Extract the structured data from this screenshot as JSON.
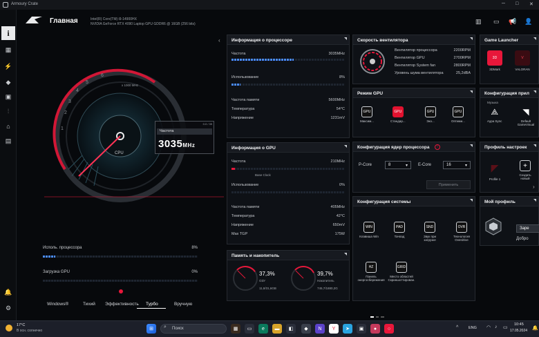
{
  "window": {
    "title": "Armoury Crate"
  },
  "header": {
    "title": "Главная",
    "cpu": "Intel(R) Core(TM) i9-14900HX",
    "gpu": "NVIDIA GeForce RTX 4090 Laptop GPU GDDR6 @ 16GB (256 bits)"
  },
  "gauge": {
    "ticks": [
      "1",
      "2",
      "3",
      "4",
      "5",
      "6"
    ],
    "unit": "x 1000 MHz",
    "label": "CPU",
    "freq_label": "Частота",
    "value": "3035",
    "value_unit": "MHz",
    "range": "0.0 / 39",
    "accent": "#e8173a"
  },
  "cpu_usage": {
    "label": "Исполь. процессора",
    "value": "8%",
    "pct": 8
  },
  "gpu_load": {
    "label": "Загрузка GPU",
    "value": "0%",
    "pct": 0
  },
  "modes": {
    "items": [
      "Windows®",
      "Тихий",
      "Эффективность",
      "Турбо",
      "Вручную"
    ],
    "active": "Турбо"
  },
  "cpu_info": {
    "title": "Информация о процессоре",
    "freq_label": "Частота",
    "freq_value": "3035MHz",
    "freq_pct": 55,
    "usage_label": "Использование",
    "usage_value": "8%",
    "usage_pct": 8,
    "rows": [
      {
        "label": "Частота памяти",
        "value": "5600MHz"
      },
      {
        "label": "Температура",
        "value": "54°C"
      },
      {
        "label": "Напряжение",
        "value": "1231mV"
      }
    ]
  },
  "gpu_info": {
    "title": "Информация о GPU",
    "freq_label": "Частота",
    "freq_value": "210MHz",
    "base_clock": "Base Clock",
    "usage_label": "Использование",
    "usage_value": "0%",
    "rows": [
      {
        "label": "Частота памяти",
        "value": "405MHz"
      },
      {
        "label": "Температура",
        "value": "42°C"
      },
      {
        "label": "Напряжение",
        "value": "650mV"
      },
      {
        "label": "Max TGP",
        "value": "175W"
      }
    ]
  },
  "memory": {
    "title": "Память и накопитель",
    "ram_pct": "37,3%",
    "ram_label": "ОЗУ",
    "ram_detail": "11,8/31,6GB",
    "ram_fill": 37.3,
    "disk_pct": "39,7%",
    "disk_label": "Накопитель",
    "disk_detail": "745,7/1880,2G",
    "disk_fill": 39.7
  },
  "fan": {
    "title": "Скорость вентилятора",
    "rows": [
      {
        "label": "Вентилятор процессора",
        "value": "2200RPM"
      },
      {
        "label": "Вентилятор GPU",
        "value": "2700RPM"
      },
      {
        "label": "Вентилятор System fan",
        "value": "2800RPM"
      },
      {
        "label": "Уровень шума вентилятора",
        "value": "25,2dBA"
      }
    ]
  },
  "gpu_mode": {
    "title": "Режим GPU",
    "items": [
      {
        "icon": "GPU",
        "label": "Максим..."
      },
      {
        "icon": "GPU",
        "label": "Стандар..."
      },
      {
        "icon": "GPU",
        "label": "Эко..."
      },
      {
        "icon": "GPU",
        "label": "Оптими..."
      }
    ]
  },
  "cores": {
    "title": "Конфигурация ядер процессора",
    "pcore_label": "P-Core",
    "pcore_value": "8",
    "ecore_label": "E-Core",
    "ecore_value": "16",
    "apply": "Применить"
  },
  "sysconfig": {
    "title": "Конфигурация системы",
    "items": [
      {
        "icon": "WIN",
        "label": "Клавиша Win"
      },
      {
        "icon": "PAD",
        "label": "Тачпад"
      },
      {
        "icon": "SND",
        "label": "Звук при загрузке"
      },
      {
        "icon": "OVR",
        "label": "Технология Overdrive"
      },
      {
        "icon": "HZ",
        "label": "Панель энергосбережения"
      },
      {
        "icon": "GRID",
        "label": "Место областей Скриншоттирован."
      }
    ]
  },
  "launcher": {
    "title": "Game Launcher",
    "items": [
      {
        "icon": "3D",
        "label": "3DMark"
      },
      {
        "icon": "V",
        "label": "VALORAN"
      }
    ]
  },
  "appconfig": {
    "title": "Конфигурация прил",
    "items": [
      {
        "label": "Аура Sync"
      },
      {
        "label": "Default GameVisual"
      }
    ],
    "sub": "Музыка"
  },
  "profiles": {
    "title": "Профиль настроек",
    "p1": "Profile 1",
    "create": "Создать новый"
  },
  "myprofile": {
    "title": "Мой профиль",
    "btn": "Заре",
    "greet": "Добро"
  },
  "taskbar": {
    "weather_temp": "17°C",
    "weather_desc": "В осн. солнечно",
    "search": "Поиск",
    "lang": "ENG",
    "time": "10:45",
    "date": "17.05.2024"
  }
}
